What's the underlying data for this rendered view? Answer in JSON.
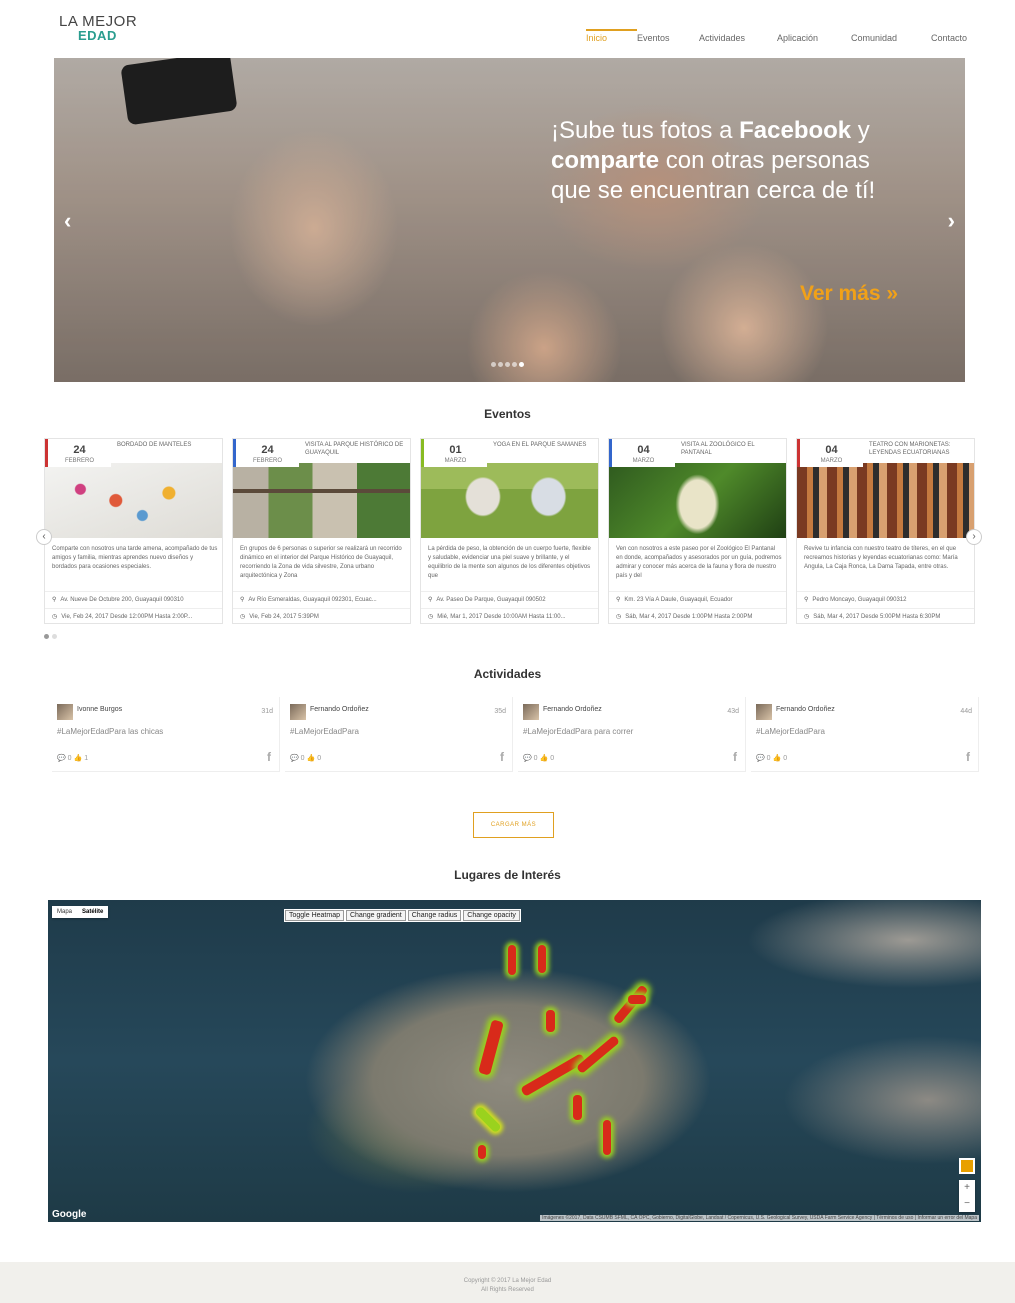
{
  "logo": {
    "line1": "LA MEJOR",
    "line2": "EDAD"
  },
  "nav": [
    {
      "label": "Inicio",
      "active": true
    },
    {
      "label": "Eventos",
      "active": false
    },
    {
      "label": "Actividades",
      "active": false
    },
    {
      "label": "Aplicación",
      "active": false
    },
    {
      "label": "Comunidad",
      "active": false
    },
    {
      "label": "Contacto",
      "active": false
    }
  ],
  "hero": {
    "line1_pre": "¡Sube tus fotos a ",
    "line1_bold": "Facebook",
    "line1_post": " y",
    "line2_bold": "comparte",
    "line2_post": " con otras personas",
    "line3": "que se encuentran cerca de tí!",
    "cta": "Ver más »",
    "prev_icon": "chevron-left-icon",
    "next_icon": "chevron-right-icon"
  },
  "events": {
    "title": "Eventos",
    "items": [
      {
        "day": "24",
        "month": "FEBRERO",
        "title": "BORDADO DE MANTELES",
        "desc": "Comparte con nosotros una tarde amena, acompañado de tus amigos y familia, mientras aprendes nuevo diseños y bordados para ocasiones especiales.",
        "address": "Av. Nueve De Octubre 200, Guayaquil 090310",
        "time": "Vie, Feb 24, 2017 Desde 12:00PM Hasta 2:00P...",
        "accent": "#cc3333"
      },
      {
        "day": "24",
        "month": "FEBRERO",
        "title": "VISITA AL PARQUE HISTÓRICO DE GUAYAQUIL",
        "desc": "En grupos de 6 personas o superior se realizará un recorrido dinámico en el interior del Parque Histórico de Guayaquil, recorriendo la Zona de vida silvestre, Zona urbano arquitectónica y Zona",
        "address": "Av Río Esmeraldas, Guayaquil 092301, Ecuac...",
        "time": "Vie, Feb 24, 2017 5:39PM",
        "accent": "#3366cc"
      },
      {
        "day": "01",
        "month": "MARZO",
        "title": "YOGA EN EL PARQUE SAMANES",
        "desc": "La pérdida de peso, la obtención de un cuerpo fuerte, flexible y saludable, evidenciar una piel suave y brillante, y el equilibrio de la mente son algunos de los diferentes objetivos que",
        "address": "Av. Paseo De Parque, Guayaquil 090502",
        "time": "Mié, Mar 1, 2017 Desde 10:00AM Hasta 11:00...",
        "accent": "#88bb22"
      },
      {
        "day": "04",
        "month": "MARZO",
        "title": "VISITA AL ZOOLÓGICO EL PANTANAL",
        "desc": "Ven con nosotros a este paseo por el Zoológico El Pantanal en donde, acompañados y asesorados por un guía, podremos admirar y conocer más acerca de la fauna y flora de nuestro país y del",
        "address": "Km. 23 Vía A Daule, Guayaquil, Ecuador",
        "time": "Sáb, Mar 4, 2017 Desde 1:00PM Hasta 2:00PM",
        "accent": "#3366cc"
      },
      {
        "day": "04",
        "month": "MARZO",
        "title": "TEATRO CON MARIONETAS: LEYENDAS ECUATORIANAS",
        "desc": "Revive tu infancia con nuestro teatro de títeres, en el que recreamos historias y leyendas ecuatorianas como: María Angula, La Caja Ronca, La Dama Tapada, entre otras.",
        "address": "Pedro Moncayo, Guayaquil 090312",
        "time": "Sáb, Mar 4, 2017 Desde 5:00PM Hasta 6:30PM",
        "accent": "#cc3333"
      }
    ]
  },
  "activities": {
    "title": "Actividades",
    "items": [
      {
        "name": "Ivonne Burgos",
        "ago": "31d",
        "msg": "#LaMejorEdadPara las chicas",
        "comments": "0",
        "likes": "1"
      },
      {
        "name": "Fernando Ordoñez",
        "ago": "35d",
        "msg": "#LaMejorEdadPara",
        "comments": "0",
        "likes": "0"
      },
      {
        "name": "Fernando Ordoñez",
        "ago": "43d",
        "msg": "#LaMejorEdadPara para correr",
        "comments": "0",
        "likes": "0"
      },
      {
        "name": "Fernando Ordoñez",
        "ago": "44d",
        "msg": "#LaMejorEdadPara",
        "comments": "0",
        "likes": "0"
      }
    ],
    "load_more": "CARGAR MÁS"
  },
  "places": {
    "title": "Lugares de Interés",
    "map_types": [
      "Mapa",
      "Satélite"
    ],
    "controls": [
      "Toggle Heatmap",
      "Change gradient",
      "Change radius",
      "Change opacity"
    ],
    "google": "Google",
    "attribution": "Imágenes ©2017, Data CSUMB SFML, CA OPC, Gobierno, DigitalGlobe, Landsat / Copernicus, U.S. Geological Survey, USDA Farm Service Agency | Términos de uso | Informar un error del Mapa",
    "zoom_in": "+",
    "zoom_out": "−"
  },
  "footer": {
    "line1": "Copyright © 2017 La Mejor Edad",
    "line2": "All Rights Reserved"
  }
}
